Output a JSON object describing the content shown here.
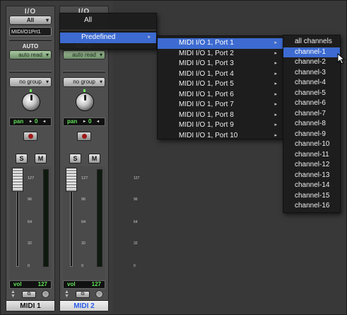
{
  "strips": [
    {
      "io_header": "I/O",
      "input_selector": "All",
      "output_selector": "MIDI/O1Prt1",
      "automation_label": "AUTO",
      "automation_mode": "auto read",
      "group": "no group",
      "pan_label": "pan",
      "pan_value": "0",
      "solo": "S",
      "mute": "M",
      "fader_scale": [
        "127",
        "96",
        "64",
        "32",
        "0"
      ],
      "vol_label": "vol",
      "vol_value": "127",
      "name": "MIDI 1"
    },
    {
      "io_header": "I/O",
      "automation_mode": "auto read",
      "group": "no group",
      "pan_label": "pan",
      "pan_value": "0",
      "solo": "S",
      "mute": "M",
      "fader_scale": [
        "127",
        "96",
        "64",
        "32",
        "0"
      ],
      "vol_label": "vol",
      "vol_value": "127",
      "name": "MIDI 2"
    }
  ],
  "menu_level1": {
    "items": [
      "All",
      "Predefined"
    ],
    "highlighted": "Predefined"
  },
  "menu_level2": {
    "items": [
      "MIDI I/O 1, Port 1",
      "MIDI I/O 1, Port 2",
      "MIDI I/O 1, Port 3",
      "MIDI I/O 1, Port 4",
      "MIDI I/O 1, Port 5",
      "MIDI I/O 1, Port 6",
      "MIDI I/O 1, Port 7",
      "MIDI I/O 1, Port 8",
      "MIDI I/O 1, Port 9",
      "MIDI I/O 1, Port 10"
    ],
    "highlighted": "MIDI I/O 1, Port 1"
  },
  "menu_level3": {
    "items": [
      "all channels",
      "channel-1",
      "channel-2",
      "channel-3",
      "channel-4",
      "channel-5",
      "channel-6",
      "channel-7",
      "channel-8",
      "channel-9",
      "channel-10",
      "channel-11",
      "channel-12",
      "channel-13",
      "channel-14",
      "channel-15",
      "channel-16"
    ],
    "highlighted": "channel-1"
  },
  "colors": {
    "highlight": "#3d6bd1",
    "meter_green": "#63e35a",
    "selected_track_name": "#2a5de8"
  },
  "icons": {
    "submenu_arrow": "▸",
    "cursor": "arrow-pointer-icon"
  }
}
